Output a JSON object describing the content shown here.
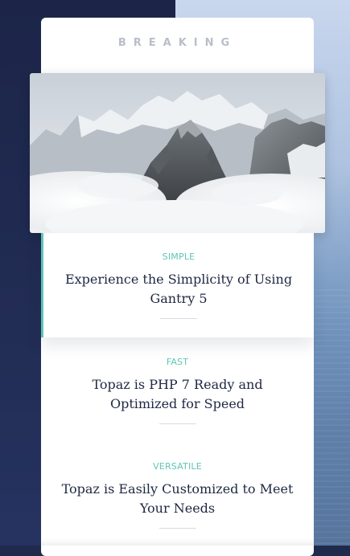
{
  "header": {
    "eyebrow": "BREAKING"
  },
  "hero": {
    "image": "mountain-peaks-above-clouds"
  },
  "articles": [
    {
      "tag": "SIMPLE",
      "title": "Experience the Simplicity of Using Gantry 5"
    },
    {
      "tag": "FAST",
      "title": "Topaz is PHP 7 Ready and Optimized for Speed"
    },
    {
      "tag": "VERSATILE",
      "title": "Topaz is Easily Customized to Meet Your Needs"
    }
  ],
  "colors": {
    "accent": "#5fc5b4",
    "navy": "#1c2548",
    "title_text": "#1e2742",
    "eyebrow_text": "#b9bec8"
  }
}
